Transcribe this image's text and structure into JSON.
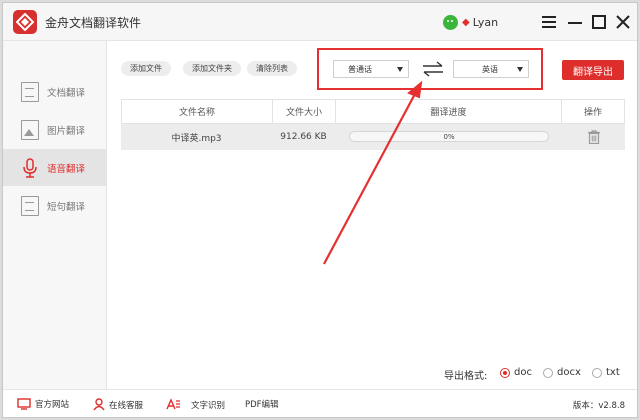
{
  "app": {
    "title": "金舟文档翻译软件"
  },
  "user": {
    "name": "Lyan"
  },
  "sidebar": {
    "items": [
      {
        "label": "文档翻译",
        "active": false
      },
      {
        "label": "图片翻译",
        "active": false
      },
      {
        "label": "语音翻译",
        "active": true
      },
      {
        "label": "短句翻译",
        "active": false
      }
    ]
  },
  "toolbar": {
    "add_file": "添加文件",
    "add_folder": "添加文件夹",
    "clear_list": "清除列表",
    "source_lang": "普通话",
    "target_lang": "英语",
    "export_button": "翻译导出"
  },
  "table": {
    "headers": [
      "文件名称",
      "文件大小",
      "翻译进度",
      "操作"
    ],
    "rows": [
      {
        "name": "中译英.mp3",
        "size": "912.66 KB",
        "progress": 0,
        "progress_label": "0%"
      }
    ]
  },
  "export_format": {
    "label": "导出格式:",
    "options": [
      "doc",
      "docx",
      "txt"
    ],
    "selected": "doc"
  },
  "footer": {
    "website": "官方网站",
    "support": "在线客服",
    "ocr": "文字识别",
    "pdf": "PDF编辑",
    "version": "版本：v2.8.8"
  },
  "colors": {
    "accent": "#de2e2b",
    "annotation": "#e5302f"
  }
}
